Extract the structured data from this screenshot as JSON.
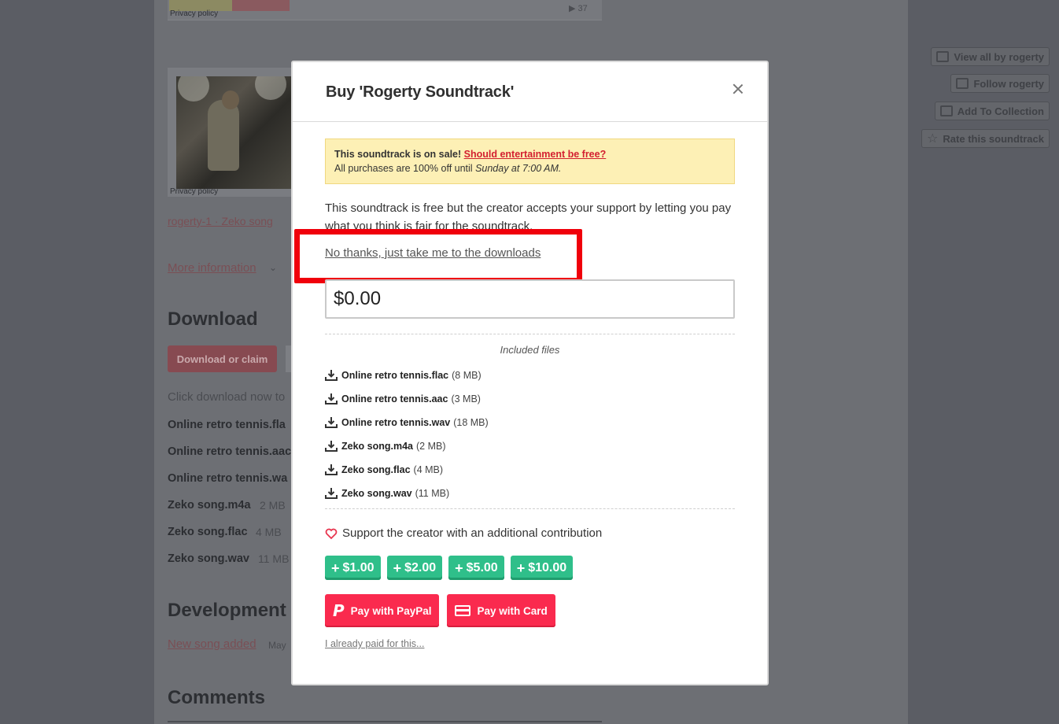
{
  "background": {
    "privacy_label_1": "Privacy policy",
    "play_count": "▶ 37",
    "privacy_label_2": "Privacy policy",
    "tags_line": "rogerty-1 · Zeko song",
    "more_information": "More information",
    "download_heading": "Download",
    "download_button": "Download or claim",
    "click_download_text": "Click download now to",
    "files": [
      {
        "name": "Online retro tennis.fla",
        "size": ""
      },
      {
        "name": "Online retro tennis.aac",
        "size": ""
      },
      {
        "name": "Online retro tennis.wa",
        "size": ""
      },
      {
        "name": "Zeko song.m4a",
        "size": "2 MB"
      },
      {
        "name": "Zeko song.flac",
        "size": "4 MB"
      },
      {
        "name": "Zeko song.wav",
        "size": "11 MB"
      }
    ],
    "devlog_heading": "Development l",
    "devlog_link": "New song added",
    "devlog_date": "May",
    "comments_heading": "Comments",
    "sidebar": {
      "view_all": "View all by rogerty",
      "follow": "Follow rogerty",
      "add_collection": "Add To Collection",
      "rate": "Rate this soundtrack"
    }
  },
  "modal": {
    "title": "Buy 'Rogerty Soundtrack'",
    "sale": {
      "headline": "This soundtrack is on sale!",
      "link": "Should entertainment be free?",
      "line2_prefix": "All purchases are 100% off until",
      "line2_time": "Sunday at 7:00 AM."
    },
    "intro": "This soundtrack is free but the creator accepts your support by letting you pay what you think is fair for the soundtrack.",
    "no_thanks": "No thanks, just take me to the downloads",
    "price_value": "$0.00",
    "included_files_label": "Included files",
    "files": [
      {
        "name": "Online retro tennis.flac",
        "size": "(8 MB)"
      },
      {
        "name": "Online retro tennis.aac",
        "size": "(3 MB)"
      },
      {
        "name": "Online retro tennis.wav",
        "size": "(18 MB)"
      },
      {
        "name": "Zeko song.m4a",
        "size": "(2 MB)"
      },
      {
        "name": "Zeko song.flac",
        "size": "(4 MB)"
      },
      {
        "name": "Zeko song.wav",
        "size": "(11 MB)"
      }
    ],
    "support_label": "Support the creator with an additional contribution",
    "tips": [
      "$1.00",
      "$2.00",
      "$5.00",
      "$10.00"
    ],
    "pay_paypal": "Pay with PayPal",
    "pay_card": "Pay with Card",
    "already_paid": "I already paid for this..."
  },
  "colors": {
    "accent_red": "#fa2a4e",
    "tip_green": "#2fbf8a",
    "highlight_red": "#f0000b",
    "sale_bg": "#fdf0b5"
  }
}
